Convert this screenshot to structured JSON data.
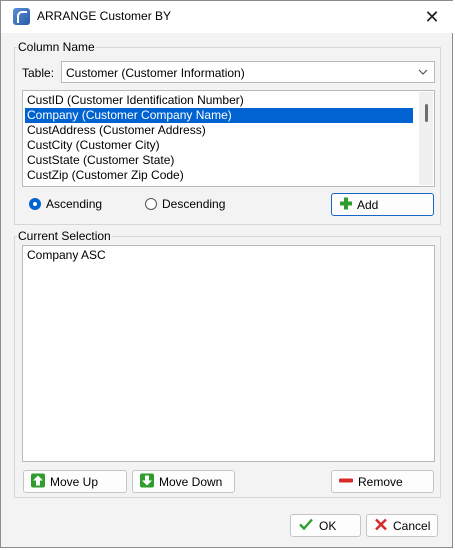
{
  "window": {
    "title": "ARRANGE Customer BY",
    "close_glyph": "✕"
  },
  "column_group": {
    "label": "Column Name",
    "table_label": "Table:",
    "table_value": "Customer  (Customer Information)",
    "columns": [
      "CustID  (Customer Identification Number)",
      "Company  (Customer Company Name)",
      "CustAddress  (Customer Address)",
      "CustCity  (Customer City)",
      "CustState  (Customer State)",
      "CustZip  (Customer Zip Code)"
    ],
    "selected_index": 1,
    "order": {
      "ascending_label": "Ascending",
      "descending_label": "Descending",
      "selected": "ascending"
    },
    "add_label": "Add"
  },
  "selection_group": {
    "label": "Current Selection",
    "items": [
      "Company ASC"
    ],
    "move_up_label": "Move Up",
    "move_down_label": "Move Down",
    "remove_label": "Remove"
  },
  "footer": {
    "ok_label": "OK",
    "cancel_label": "Cancel"
  },
  "colors": {
    "accent": "#0063d1",
    "icon_green": "#2e9d2e",
    "icon_red": "#d62a2a"
  }
}
